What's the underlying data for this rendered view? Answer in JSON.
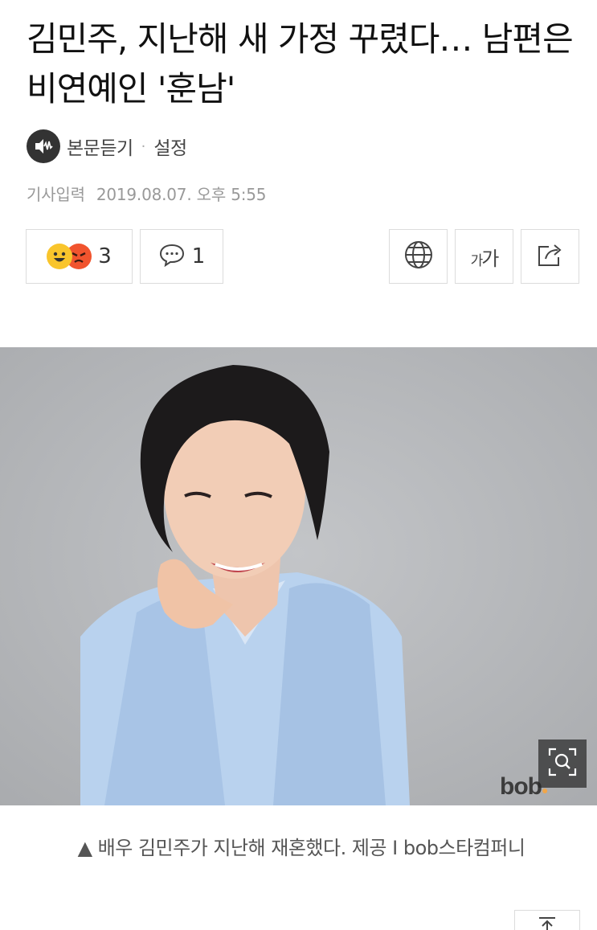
{
  "article": {
    "title": "김민주, 지난해 새 가정 꾸렸다… 남편은 비연예인 '훈남'",
    "listen_label": "본문듣기",
    "separator": "·",
    "settings_label": "설정",
    "byline_label": "기사입력",
    "published_at": "2019.08.07. 오후 5:55"
  },
  "toolbar": {
    "reaction_count": "3",
    "comment_count": "1",
    "font_size_label_small": "가",
    "font_size_label_large": "가"
  },
  "photo": {
    "watermark": "bob",
    "caption": "▲ 배우 김민주가 지난해 재혼했다. 제공 I bob스타컴퍼니"
  },
  "icons": {
    "listen": "speaker-wave-icon",
    "reaction_happy": "happy-face-icon",
    "reaction_angry": "angry-face-icon",
    "comment": "speech-bubble-icon",
    "translate": "globe-icon",
    "share": "share-icon",
    "zoom": "zoom-icon",
    "scroll_top": "arrow-up-icon"
  },
  "colors": {
    "happy_emoji": "#f9c52c",
    "angry_emoji": "#f1542e",
    "watermark_accent": "#f0a64a"
  }
}
